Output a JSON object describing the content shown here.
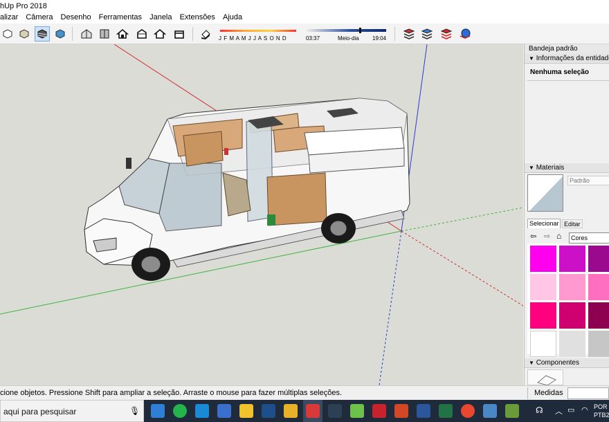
{
  "window": {
    "title": "hUp Pro 2018"
  },
  "menu": [
    "alizar",
    "Câmera",
    "Desenho",
    "Ferramentas",
    "Janela",
    "Extensões",
    "Ajuda"
  ],
  "shadow_settings": {
    "months_label": "J F M A M J J A S O N D",
    "time_start": "03:37",
    "time_mid": "Meio-dia",
    "time_end": "19:04"
  },
  "tray": {
    "title": "Bandeja padrão",
    "entity_info": {
      "header": "Informações da entidade",
      "value": "Nenhuma seleção"
    },
    "materials": {
      "header": "Materiais",
      "current_name": "Padrão",
      "tab_select": "Selecionar",
      "tab_edit": "Editar",
      "library": "Cores",
      "swatches": [
        "#ff00ee",
        "#cc10c8",
        "#9b0a8e",
        "#ffc6e6",
        "#ff99d0",
        "#ff6fbf",
        "#ff007f",
        "#cf0070",
        "#8e0050",
        "#ffffff",
        "#e0e0e0",
        "#c6c6c6"
      ]
    },
    "components": {
      "header": "Componentes"
    }
  },
  "status": {
    "hint": "cione objetos. Pressione Shift para ampliar a seleção. Arraste o mouse para fazer múltiplas seleções.",
    "measure_label": "Medidas"
  },
  "taskbar": {
    "search_placeholder": "aqui para pesquisar",
    "lang1": "POR",
    "lang2": "PTB2"
  },
  "colors": {
    "accent": "#0a66d0",
    "viewport_bg": "#dcdcd6",
    "taskbar_bg": "#1f2a3a"
  }
}
